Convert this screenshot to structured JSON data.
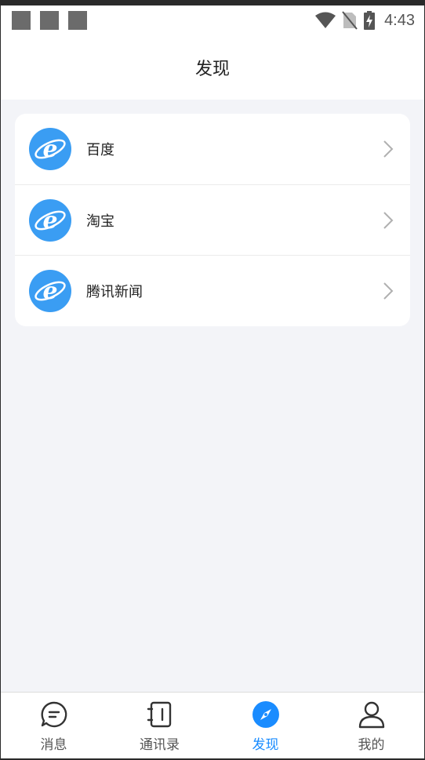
{
  "status_bar": {
    "time": "4:43"
  },
  "header": {
    "title": "发现"
  },
  "discover_list": [
    {
      "label": "百度",
      "icon": "ie-browser-icon"
    },
    {
      "label": "淘宝",
      "icon": "ie-browser-icon"
    },
    {
      "label": "腾讯新闻",
      "icon": "ie-browser-icon"
    }
  ],
  "bottom_nav": [
    {
      "label": "消息",
      "icon": "message-icon",
      "active": false
    },
    {
      "label": "通讯录",
      "icon": "contacts-icon",
      "active": false
    },
    {
      "label": "发现",
      "icon": "compass-icon",
      "active": true
    },
    {
      "label": "我的",
      "icon": "person-icon",
      "active": false
    }
  ],
  "colors": {
    "accent": "#1a8cff",
    "icon_blue": "#3a9df3",
    "background": "#f3f4f8"
  }
}
